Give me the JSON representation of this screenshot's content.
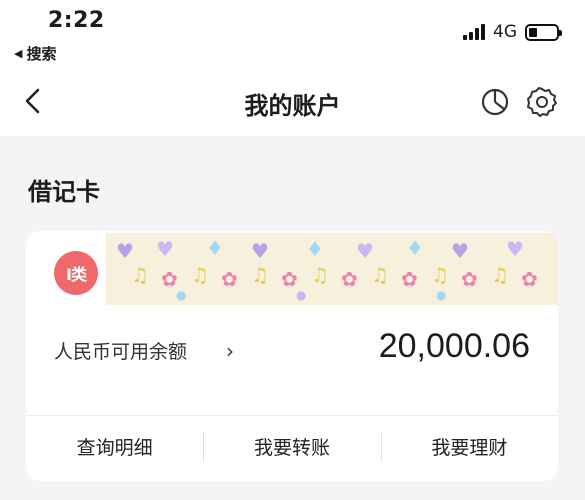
{
  "status_bar": {
    "time": "2:22",
    "back_app_label": "搜索",
    "network": "4G",
    "battery_level": 0.3
  },
  "nav": {
    "title": "我的账户"
  },
  "section": {
    "title": "借记卡"
  },
  "card": {
    "badge": "I类",
    "balance_label": "人民币可用余额",
    "balance_chevron": "›",
    "balance_amount": "20,000.06",
    "actions": [
      {
        "label": "查询明细"
      },
      {
        "label": "我要转账"
      },
      {
        "label": "我要理财"
      }
    ]
  },
  "colors": {
    "badge_bg": "#f0696a",
    "page_bg": "#f4f4f6",
    "card_bg": "#ffffff"
  },
  "icons": {
    "nav_back": "chevron-left-icon",
    "nav_chart": "pie-chart-icon",
    "nav_settings": "gear-icon"
  }
}
